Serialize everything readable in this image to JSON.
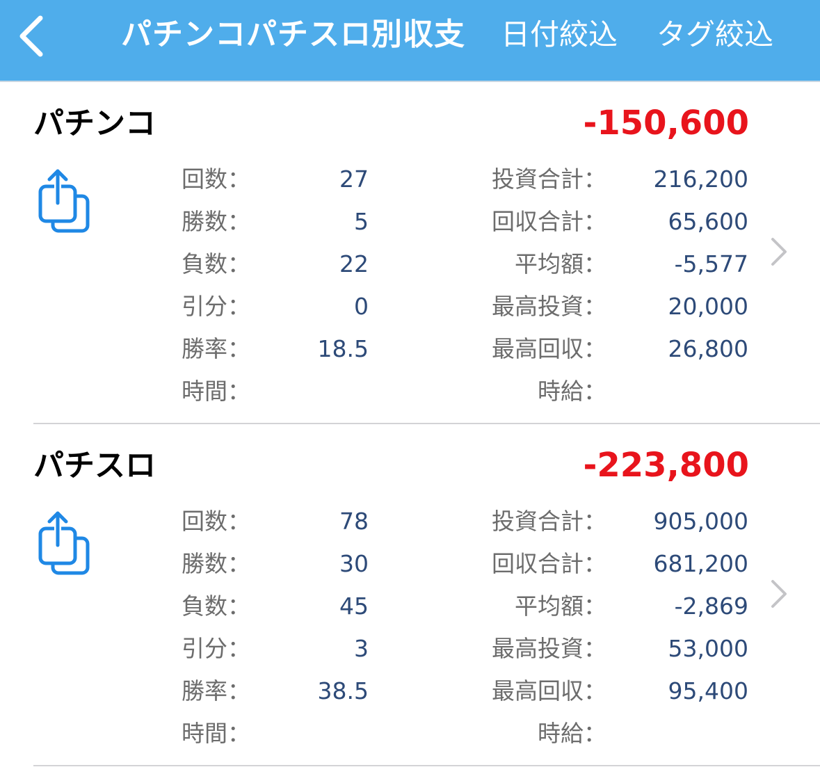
{
  "navbar": {
    "back_icon": "chevron-left-icon",
    "title": "パチンコパチスロ別収支",
    "date_filter_label": "日付絞込",
    "tag_filter_label": "タグ絞込",
    "background_color": "#4fadeb"
  },
  "colors": {
    "accent": "#1f88e5",
    "negative_total": "#e8141c",
    "value_text": "#2d4a78",
    "label_text": "#6c6c6c"
  },
  "sections": [
    {
      "title": "パチンコ",
      "total": "-150,600",
      "share_icon": "share-icon",
      "left_stats": [
        {
          "label": "回数：",
          "value": "27"
        },
        {
          "label": "勝数：",
          "value": "5"
        },
        {
          "label": "負数：",
          "value": "22"
        },
        {
          "label": "引分：",
          "value": "0"
        },
        {
          "label": "勝率：",
          "value": "18.5"
        },
        {
          "label": "時間：",
          "value": ""
        }
      ],
      "right_stats": [
        {
          "label": "投資合計：",
          "value": "216,200"
        },
        {
          "label": "回収合計：",
          "value": "65,600"
        },
        {
          "label": "平均額：",
          "value": "-5,577"
        },
        {
          "label": "最高投資：",
          "value": "20,000"
        },
        {
          "label": "最高回収：",
          "value": "26,800"
        },
        {
          "label": "時給：",
          "value": ""
        }
      ]
    },
    {
      "title": "パチスロ",
      "total": "-223,800",
      "share_icon": "share-icon",
      "left_stats": [
        {
          "label": "回数：",
          "value": "78"
        },
        {
          "label": "勝数：",
          "value": "30"
        },
        {
          "label": "負数：",
          "value": "45"
        },
        {
          "label": "引分：",
          "value": "3"
        },
        {
          "label": "勝率：",
          "value": "38.5"
        },
        {
          "label": "時間：",
          "value": ""
        }
      ],
      "right_stats": [
        {
          "label": "投資合計：",
          "value": "905,000"
        },
        {
          "label": "回収合計：",
          "value": "681,200"
        },
        {
          "label": "平均額：",
          "value": "-2,869"
        },
        {
          "label": "最高投資：",
          "value": "53,000"
        },
        {
          "label": "最高回収：",
          "value": "95,400"
        },
        {
          "label": "時給：",
          "value": ""
        }
      ]
    }
  ]
}
